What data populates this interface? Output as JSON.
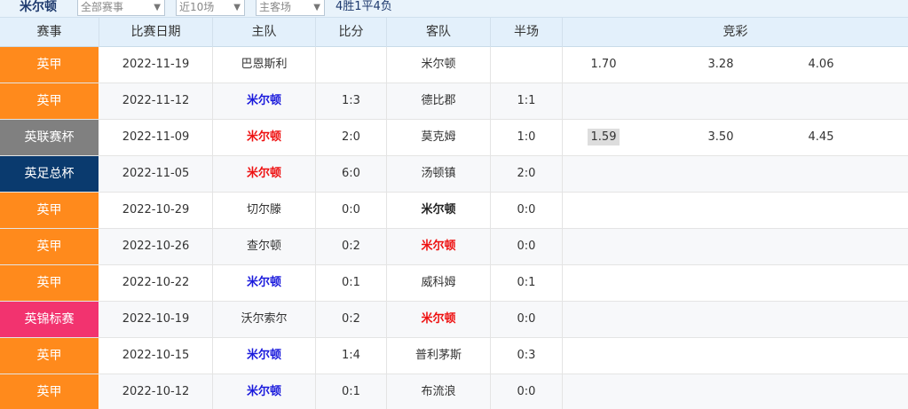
{
  "top": {
    "team": "米尔顿",
    "filter_competition": "全部赛事",
    "filter_range": "近10场",
    "filter_venue": "主客场",
    "record": "4胜1平4负"
  },
  "headers": [
    "赛事",
    "比赛日期",
    "主队",
    "比分",
    "客队",
    "半场",
    "竞彩"
  ],
  "colors": {
    "premier": "#ff8a1c",
    "league_cup": "#808080",
    "fa_trophy": "#0a3a6e",
    "championship_trophy": "#f2336f"
  },
  "rows": [
    {
      "comp": "英甲",
      "comp_color": "#ff8a1c",
      "date": "2022-11-19",
      "home": "巴恩斯利",
      "home_style": "plain",
      "score": "",
      "away": "米尔顿",
      "away_style": "plain",
      "half": "",
      "odds": [
        "1.70",
        "3.28",
        "4.06"
      ],
      "odds_hl": false
    },
    {
      "comp": "英甲",
      "comp_color": "#ff8a1c",
      "date": "2022-11-12",
      "home": "米尔顿",
      "home_style": "blue",
      "score": "1:3",
      "away": "德比郡",
      "away_style": "plain",
      "half": "1:1",
      "odds": [
        "",
        "",
        ""
      ],
      "odds_hl": false
    },
    {
      "comp": "英联赛杯",
      "comp_color": "#808080",
      "date": "2022-11-09",
      "home": "米尔顿",
      "home_style": "red",
      "score": "2:0",
      "away": "莫克姆",
      "away_style": "plain",
      "half": "1:0",
      "odds": [
        "1.59",
        "3.50",
        "4.45"
      ],
      "odds_hl": true
    },
    {
      "comp": "英足总杯",
      "comp_color": "#0a3a6e",
      "date": "2022-11-05",
      "home": "米尔顿",
      "home_style": "red",
      "score": "6:0",
      "away": "汤顿镇",
      "away_style": "plain",
      "half": "2:0",
      "odds": [
        "",
        "",
        ""
      ],
      "odds_hl": false
    },
    {
      "comp": "英甲",
      "comp_color": "#ff8a1c",
      "date": "2022-10-29",
      "home": "切尔滕",
      "home_style": "plain",
      "score": "0:0",
      "away": "米尔顿",
      "away_style": "dark",
      "half": "0:0",
      "odds": [
        "",
        "",
        ""
      ],
      "odds_hl": false
    },
    {
      "comp": "英甲",
      "comp_color": "#ff8a1c",
      "date": "2022-10-26",
      "home": "查尔顿",
      "home_style": "plain",
      "score": "0:2",
      "away": "米尔顿",
      "away_style": "red",
      "half": "0:0",
      "odds": [
        "",
        "",
        ""
      ],
      "odds_hl": false
    },
    {
      "comp": "英甲",
      "comp_color": "#ff8a1c",
      "date": "2022-10-22",
      "home": "米尔顿",
      "home_style": "blue",
      "score": "0:1",
      "away": "威科姆",
      "away_style": "plain",
      "half": "0:1",
      "odds": [
        "",
        "",
        ""
      ],
      "odds_hl": false
    },
    {
      "comp": "英锦标赛",
      "comp_color": "#f2336f",
      "date": "2022-10-19",
      "home": "沃尔索尔",
      "home_style": "plain",
      "score": "0:2",
      "away": "米尔顿",
      "away_style": "red",
      "half": "0:0",
      "odds": [
        "",
        "",
        ""
      ],
      "odds_hl": false
    },
    {
      "comp": "英甲",
      "comp_color": "#ff8a1c",
      "date": "2022-10-15",
      "home": "米尔顿",
      "home_style": "blue",
      "score": "1:4",
      "away": "普利茅斯",
      "away_style": "plain",
      "half": "0:3",
      "odds": [
        "",
        "",
        ""
      ],
      "odds_hl": false
    },
    {
      "comp": "英甲",
      "comp_color": "#ff8a1c",
      "date": "2022-10-12",
      "home": "米尔顿",
      "home_style": "blue",
      "score": "0:1",
      "away": "布流浪",
      "away_style": "plain",
      "half": "0:0",
      "odds": [
        "",
        "",
        ""
      ],
      "odds_hl": false
    }
  ]
}
